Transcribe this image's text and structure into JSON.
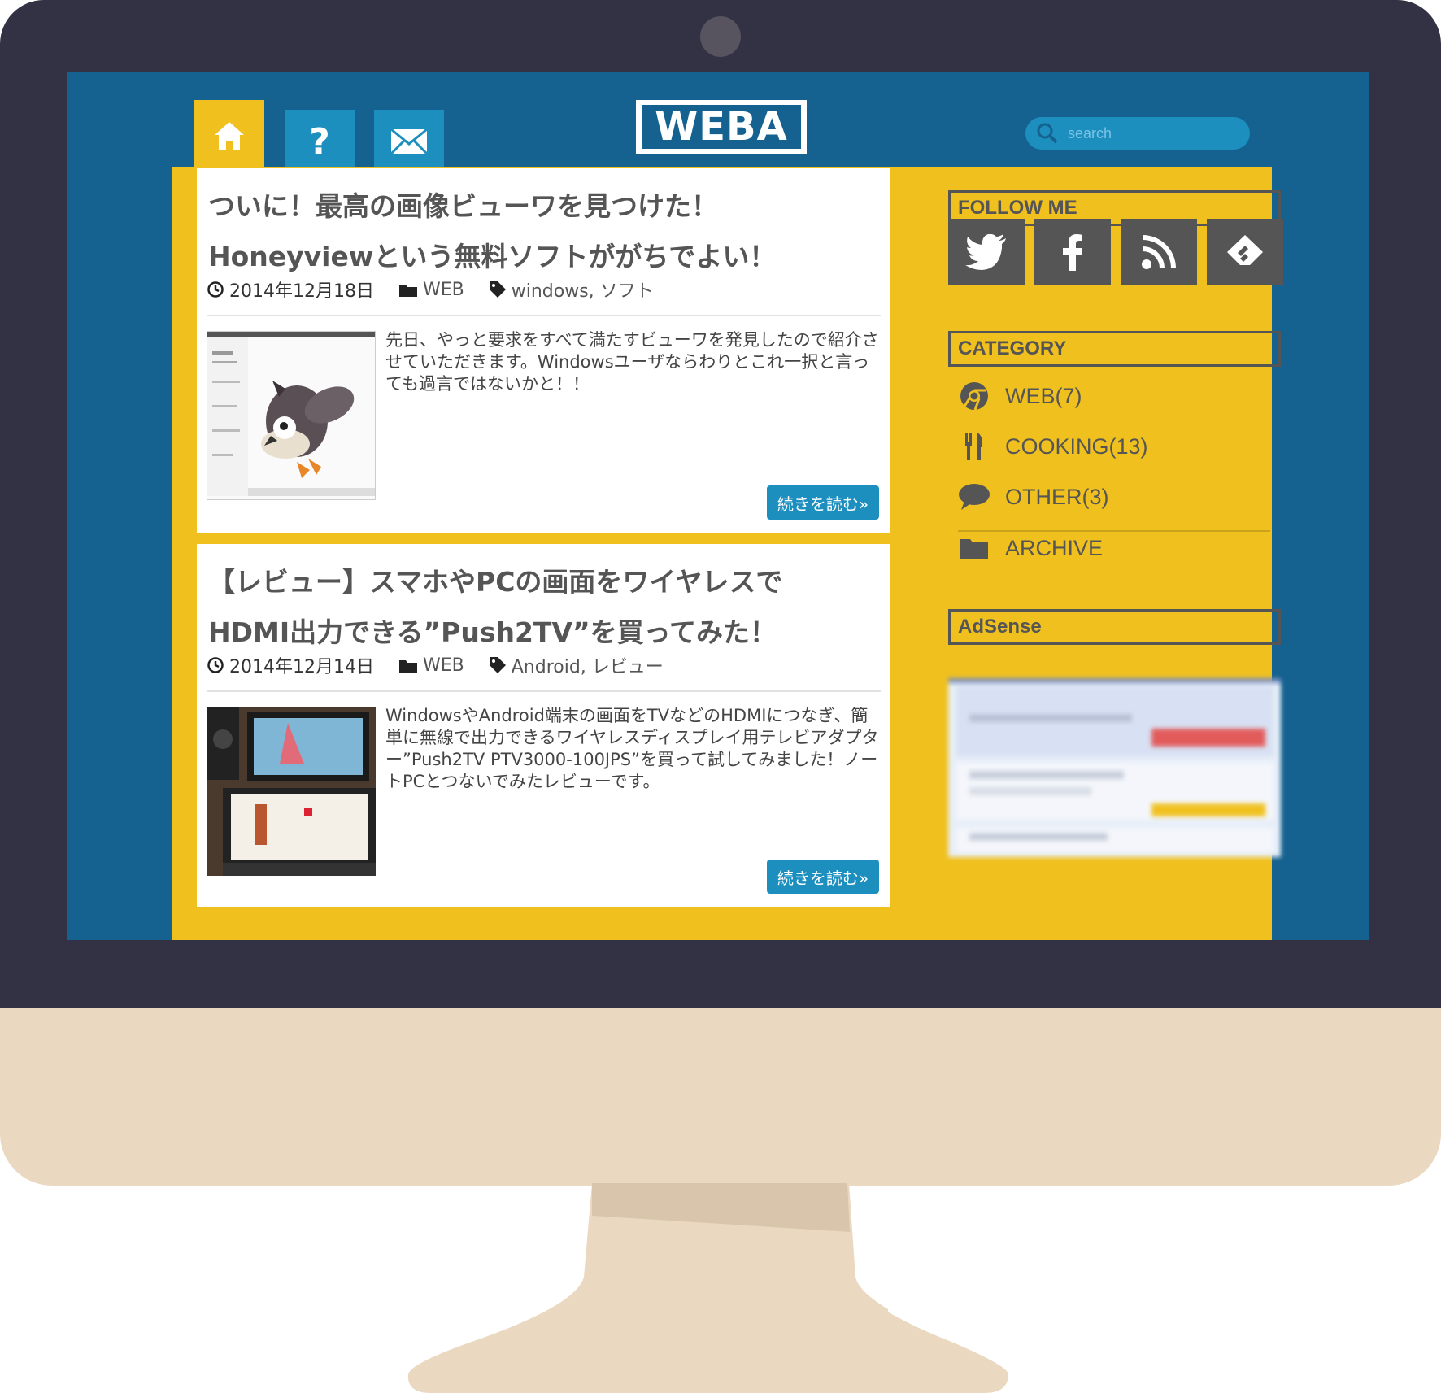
{
  "nav": {
    "logo_text": "WEBA",
    "search_placeholder": "search",
    "tabs": [
      {
        "name": "home",
        "icon": "home-icon"
      },
      {
        "name": "help",
        "icon": "question-icon"
      },
      {
        "name": "contact",
        "icon": "mail-icon"
      }
    ]
  },
  "posts": [
    {
      "title_line1": "ついに！最高の画像ビューワを見つけた！",
      "title_line2": "Honeyviewという無料ソフトががちでよい！",
      "date": "2014年12月18日",
      "category": "WEB",
      "tags": "windows, ソフト",
      "excerpt": "先日、やっと要求をすべて満たすビューワを発見したので紹介させていただきます。Windowsユーザならわりとこれ一択と言っても過言ではないかと！！",
      "more": "続きを読む»"
    },
    {
      "title_line1": "【レビュー】スマホやPCの画面をワイヤレスで",
      "title_line2": "HDMI出力できる”Push2TV”を買ってみた！",
      "date": "2014年12月14日",
      "category": "WEB",
      "tags": "Android, レビュー",
      "excerpt": "WindowsやAndroid端末の画面をTVなどのHDMIにつなぎ、簡単に無線で出力できるワイヤレスディスプレイ用テレビアダプター”Push2TV PTV3000-100JPS”を買って試してみました！ノートPCとつないでみたレビューです。",
      "more": "続きを読む»"
    }
  ],
  "sidebar": {
    "follow_title": "FOLLOW ME",
    "social": [
      "twitter-icon",
      "facebook-icon",
      "rss-icon",
      "feedly-icon"
    ],
    "category_title": "CATEGORY",
    "categories": [
      {
        "label": "WEB(7)",
        "icon": "chrome-icon"
      },
      {
        "label": "COOKING(13)",
        "icon": "fork-knife-icon"
      },
      {
        "label": "OTHER(3)",
        "icon": "speech-bubble-icon"
      },
      {
        "label": "ARCHIVE",
        "icon": "folder-icon"
      }
    ],
    "adsense_title": "AdSense"
  },
  "colors": {
    "screen_bg": "#15618f",
    "accent_yellow": "#f0c11e",
    "accent_blue": "#1d8fbe",
    "bezel": "#323244",
    "stand": "#ead9c0"
  }
}
